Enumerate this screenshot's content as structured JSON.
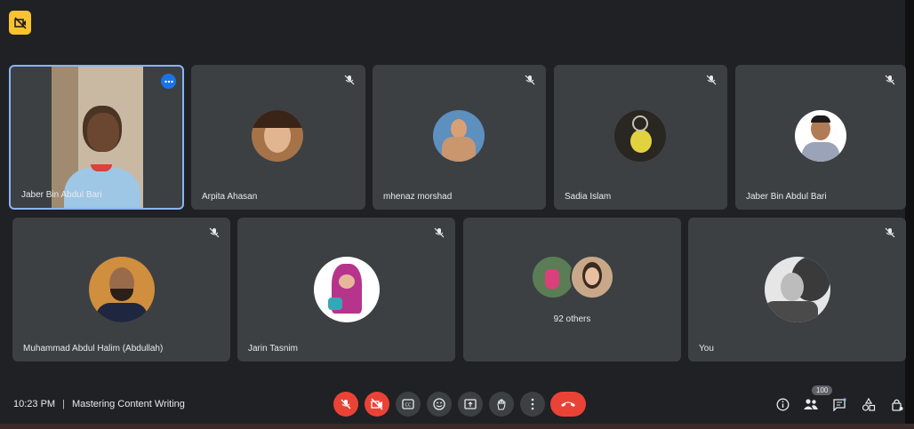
{
  "meeting": {
    "time": "10:23 PM",
    "title": "Mastering Content Writing",
    "participant_count": "100",
    "others_label": "92 others"
  },
  "participants": [
    {
      "name": "Jaber Bin Abdul Bari",
      "role": "active-speaker"
    },
    {
      "name": "Arpita Ahasan"
    },
    {
      "name": "mhenaz morshad"
    },
    {
      "name": "Sadia Islam"
    },
    {
      "name": "Jaber Bin Abdul Bari"
    },
    {
      "name": "Muhammad Abdul Halim (Abdullah)"
    },
    {
      "name": "Jarin Tasnim"
    },
    {
      "name": "You"
    }
  ],
  "controls": [
    "mic-off-icon",
    "camera-off-icon",
    "captions-icon",
    "emoji-icon",
    "present-icon",
    "raise-hand-icon",
    "more-options-icon",
    "end-call-icon"
  ],
  "right_controls": [
    "info-icon",
    "people-icon",
    "chat-icon",
    "activities-icon",
    "host-controls-icon"
  ],
  "colors": {
    "background": "#202124",
    "tile": "#3c4043",
    "accent": "#8ab4f8",
    "danger": "#ea4335",
    "badge": "#f9c32d"
  }
}
